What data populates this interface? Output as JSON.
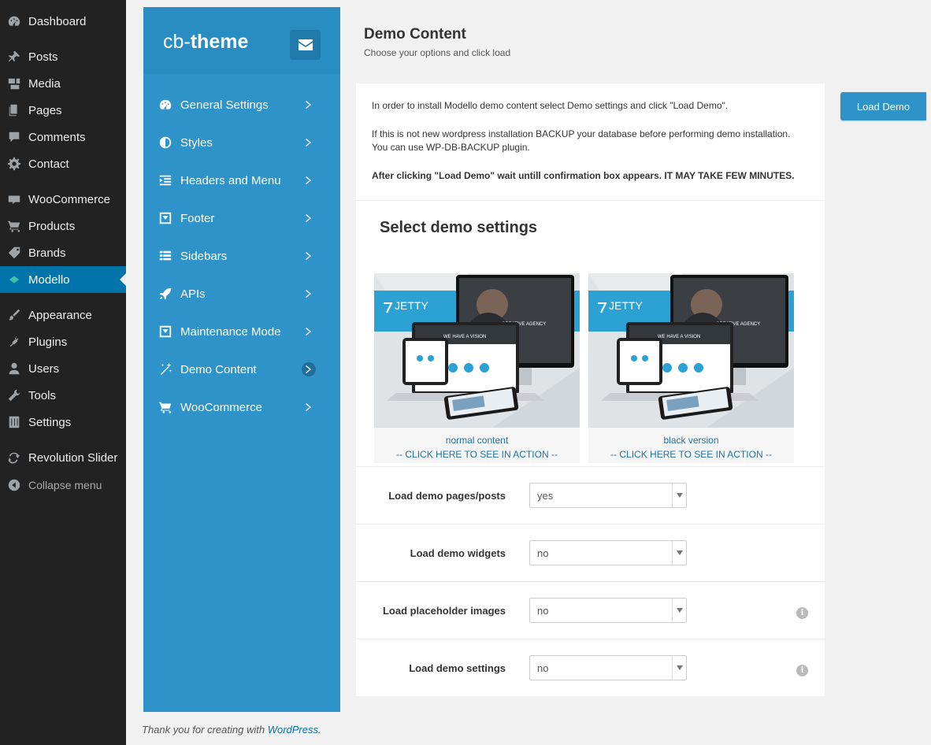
{
  "wp_menu": [
    {
      "label": "Dashboard",
      "icon": "dashboard-icon"
    },
    {
      "label": "Posts",
      "icon": "pin-icon"
    },
    {
      "label": "Media",
      "icon": "media-icon"
    },
    {
      "label": "Pages",
      "icon": "pages-icon"
    },
    {
      "label": "Comments",
      "icon": "comment-icon"
    },
    {
      "label": "Contact",
      "icon": "gear-icon"
    },
    {
      "label": "WooCommerce",
      "icon": "woo-icon"
    },
    {
      "label": "Products",
      "icon": "cart-icon"
    },
    {
      "label": "Brands",
      "icon": "tag-icon"
    },
    {
      "label": "Modello",
      "icon": "diamond-icon"
    },
    {
      "label": "Appearance",
      "icon": "brush-icon"
    },
    {
      "label": "Plugins",
      "icon": "plug-icon"
    },
    {
      "label": "Users",
      "icon": "user-icon"
    },
    {
      "label": "Tools",
      "icon": "wrench-icon"
    },
    {
      "label": "Settings",
      "icon": "sliders-icon"
    },
    {
      "label": "Revolution Slider",
      "icon": "refresh-icon"
    },
    {
      "label": "Collapse menu",
      "icon": "collapse-icon"
    }
  ],
  "theme": {
    "logo_light": "cb-",
    "logo_bold": "theme",
    "nav": [
      {
        "label": "General Settings",
        "icon": "dashboard-icon"
      },
      {
        "label": "Styles",
        "icon": "contrast-icon"
      },
      {
        "label": "Headers and Menu",
        "icon": "indent-icon"
      },
      {
        "label": "Footer",
        "icon": "footer-box-icon"
      },
      {
        "label": "Sidebars",
        "icon": "list-icon"
      },
      {
        "label": "APIs",
        "icon": "rocket-icon"
      },
      {
        "label": "Maintenance Mode",
        "icon": "footer-box-icon"
      },
      {
        "label": "Demo Content",
        "icon": "magic-wand-icon"
      },
      {
        "label": "WooCommerce",
        "icon": "cart-icon"
      }
    ]
  },
  "content": {
    "title": "Demo Content",
    "subtitle": "Choose your options and click load",
    "intro_1": "In order to install Modello demo content select Demo settings and click \"Load Demo\".",
    "intro_2a": "If this is not new wordpress installation BACKUP your database before performing demo installation.",
    "intro_2b": "You can use WP-DB-BACKUP plugin.",
    "intro_3": "After clicking \"Load Demo\" wait untill confirmation box appears. IT MAY TAKE FEW MINUTES.",
    "select_title": "Select demo settings",
    "demos": [
      {
        "name": "normal content",
        "link": "-- CLICK HERE TO SEE IN ACTION --",
        "brand": "JETTY",
        "headline": "WE HAVE A VISION",
        "agency": "CREATIVE AGENCY"
      },
      {
        "name": "black version",
        "link": "-- CLICK HERE TO SEE IN ACTION --",
        "brand": "JETTY",
        "headline": "WE HAVE A VISION",
        "agency": "CREATIVE AGENCY"
      }
    ],
    "options": [
      {
        "label": "Load demo pages/posts",
        "value": "yes",
        "info": false
      },
      {
        "label": "Load demo widgets",
        "value": "no",
        "info": false
      },
      {
        "label": "Load placeholder images",
        "value": "no",
        "info": true
      },
      {
        "label": "Load demo settings",
        "value": "no",
        "info": true
      }
    ]
  },
  "load_demo_label": "Load Demo",
  "footer": {
    "text": "Thank you for creating with ",
    "link": "WordPress",
    "end": "."
  },
  "colors": {
    "accent": "#2e93c9",
    "wp_active": "#0073aa",
    "sidebar_bg": "#222222"
  }
}
